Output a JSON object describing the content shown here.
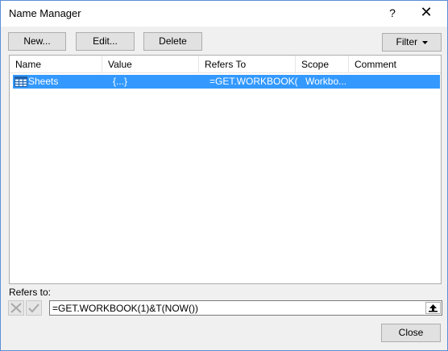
{
  "window": {
    "title": "Name Manager",
    "help_label": "?",
    "close_glyph": "✕"
  },
  "toolbar": {
    "new_label": "New...",
    "edit_label": "Edit...",
    "delete_label": "Delete",
    "filter_label": "Filter"
  },
  "table": {
    "columns": [
      "Name",
      "Value",
      "Refers To",
      "Scope",
      "Comment"
    ],
    "rows": [
      {
        "name": "Sheets",
        "value": "{...}",
        "refers_to": "=GET.WORKBOOK(...",
        "scope": "Workbo...",
        "comment": ""
      }
    ]
  },
  "refers_to": {
    "label": "Refers to:",
    "value": "=GET.WORKBOOK(1)&T(NOW())"
  },
  "footer": {
    "close_label": "Close"
  },
  "colors": {
    "selection": "#3399ff",
    "window_border": "#5b8fd6",
    "dialog_bg": "#f0f0f0"
  },
  "icons": [
    "table-icon",
    "cancel-x-icon",
    "check-icon",
    "collapse-dialog-icon",
    "chevron-down-icon"
  ]
}
